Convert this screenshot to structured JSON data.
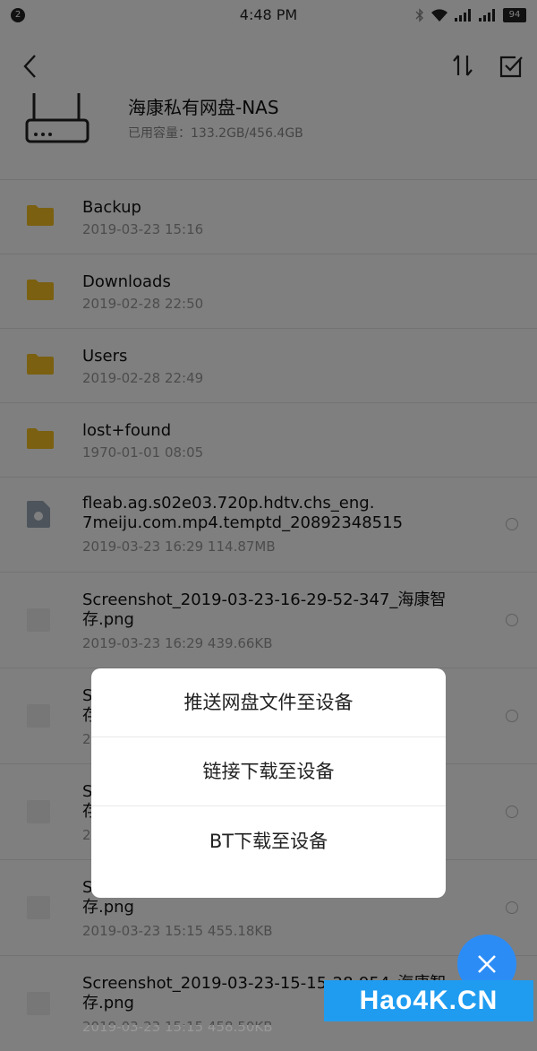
{
  "status_bar": {
    "notification_count": "2",
    "time": "4:48 PM",
    "battery": "94",
    "icons": [
      "bluetooth-icon",
      "wifi-icon",
      "signal-icon",
      "signal-icon",
      "battery-icon"
    ]
  },
  "toolbar": {
    "back_icon": "chevron-left-icon",
    "sort_icon": "sort-icon",
    "select_icon": "checkbox-icon"
  },
  "device": {
    "name": "海康私有网盘-NAS",
    "capacity": "已用容量：133.2GB/456.4GB"
  },
  "files": [
    {
      "name": "Backup",
      "meta": "2019-03-23  15:16",
      "type": "folder"
    },
    {
      "name": "Downloads",
      "meta": "2019-02-28  22:50",
      "type": "folder"
    },
    {
      "name": "Users",
      "meta": "2019-02-28  22:49",
      "type": "folder"
    },
    {
      "name": "lost+found",
      "meta": "1970-01-01  08:05",
      "type": "folder"
    },
    {
      "name": "fleab.ag.s02e03.720p.hdtv.chs_eng.\n7meiju.com.mp4.temptd_20892348515",
      "meta": "2019-03-23  16:29  114.87MB",
      "type": "cloud-file"
    },
    {
      "name": "Screenshot_2019-03-23-16-29-52-347_海康智\n存.png",
      "meta": "2019-03-23  16:29  439.66KB",
      "type": "image"
    },
    {
      "name": "S\n存",
      "meta": "2",
      "type": "image"
    },
    {
      "name": "S\n存",
      "meta": "2",
      "type": "image"
    },
    {
      "name": "S\n存.png",
      "meta": "2019-03-23  15:15  455.18KB",
      "type": "image"
    },
    {
      "name": "Screenshot_2019-03-23-15-15-28-954_海康智\n存.png",
      "meta": "2019-03-23  15:15  458.50KB",
      "type": "image"
    }
  ],
  "dialog": {
    "options": [
      "推送网盘文件至设备",
      "链接下载至设备",
      "BT下载至设备"
    ]
  },
  "fab": {
    "icon": "close-icon"
  },
  "watermark": "Hao4K.CN",
  "colors": {
    "accent": "#2b8cf6",
    "folder": "#f4c020",
    "watermark": "#1f9cf0"
  }
}
